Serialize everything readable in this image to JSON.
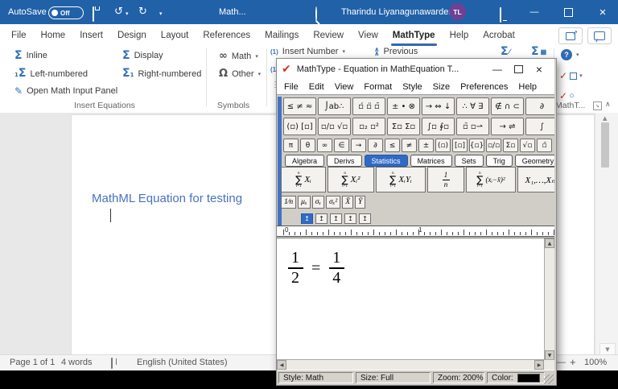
{
  "colors": {
    "titlebar_blue": "#2161a8",
    "accent_blue": "#3272b8",
    "tab_underline": "#3268b1",
    "avatar_purple": "#6e4196",
    "heading_blue": "#4a72bd",
    "selected_palette_tab_blue": "#316ac5"
  },
  "word": {
    "titlebar": {
      "autosave": "AutoSave",
      "autosave_state": "Off",
      "doc_title": "Math...",
      "user": "Tharindu Liyanagunawardena",
      "initials": "TL"
    },
    "icons": {
      "undo": "↺",
      "redo": "↻",
      "chevron": "▾",
      "minimize": "—",
      "close": "×",
      "collapse": "∧",
      "launcher_arrow": "↘",
      "up_chevron": "∧",
      "scroll_up": "▲",
      "scroll_down": "▼"
    },
    "tabs": [
      "File",
      "Home",
      "Insert",
      "Design",
      "Layout",
      "References",
      "Mailings",
      "Review",
      "View",
      "MathType",
      "Help",
      "Acrobat"
    ],
    "active_tab": "MathType",
    "ribbon": {
      "sigma": "Σ",
      "one": "1",
      "pen": "✎",
      "infinity": "∞",
      "omega": "Ω",
      "inline": "Inline",
      "display": "Display",
      "left_numbered": "Left-numbered",
      "right_numbered": "Right-numbered",
      "open_panel": "Open Math Input Panel",
      "math": "Math",
      "other": "Other",
      "insert_equations_group": "Insert Equations",
      "symbols_group": "Symbols",
      "insert_number_icon": "(1)",
      "insert_number": "Insert Number",
      "previous": "Previous",
      "toggle_tex_slash": "∕",
      "grid_glyph": "▦",
      "help": "?",
      "check": "✓",
      "circle_o": "○",
      "mathtype_group": "MathT...",
      "partial_icon": "(1",
      "overflow_dots": "⋮"
    },
    "document": {
      "heading": "MathML Equation for testing"
    },
    "status": {
      "page": "Page 1 of 1",
      "words": "4 words",
      "language": "English (United States)",
      "zoom_minus": "—",
      "zoom_plus": "+",
      "zoom_level": "100%"
    }
  },
  "mt": {
    "logo": "✔",
    "title": "MathType - Equation in MathEquation T...",
    "window_buttons": {
      "minimize": "—",
      "close": "×"
    },
    "menu": [
      "File",
      "Edit",
      "View",
      "Format",
      "Style",
      "Size",
      "Preferences",
      "Help"
    ],
    "row1": [
      "≤ ≠ ≈",
      "⌡ab∴",
      "▫́ ▫̈ ▫̄",
      "± • ⊗",
      "→ ⇔ ↓",
      "∴ ∀ ∃",
      "∉ ∩ ⊂",
      "∂"
    ],
    "row2": [
      "(▫) [▫]",
      "▫∕▫ √▫",
      "▫₂ ▫²",
      "Σ▫ Σ▫",
      "∫▫ ∮▫",
      "▫̄ ▫⇀",
      "→ ⇌",
      "∫"
    ],
    "smallbar": [
      "π",
      "θ",
      "∞",
      "∈",
      "→",
      "∂",
      "≤",
      "≠",
      "±",
      "(▫)",
      "[▫]",
      "{▫}",
      "▫∕▫",
      "Σ▫",
      "√▫",
      "▫̄"
    ],
    "tabs": [
      "Algebra",
      "Derivs",
      "Statistics",
      "Matrices",
      "Sets",
      "Trig",
      "Geometry"
    ],
    "active_tab": "Statistics",
    "templates": {
      "sigma": "∑",
      "sup": "n",
      "sub": "i=1",
      "t1": "Xᵢ",
      "t2": "Xᵢ²",
      "t3": "XᵢYᵢ",
      "t4_num": "1",
      "t4_den": "n",
      "t5": "(xᵢ−x̄)²",
      "t6": "X₁,…,Xₙ"
    },
    "small_templates": [
      "1∕n",
      "μₓ",
      "σₓ",
      "σₓ²",
      "X̄",
      "Ȳ"
    ],
    "align_icon": "↥",
    "ruler": [
      "0",
      "1"
    ],
    "equation": {
      "frac1_num": "1",
      "frac1_den": "2",
      "relation": "=",
      "frac2_num": "1",
      "frac2_den": "4"
    },
    "status": {
      "style": "Style: Math",
      "size": "Size: Full",
      "zoom": "Zoom: 200%",
      "color_label": "Color:"
    },
    "scroll": {
      "up": "▲",
      "down": "▼",
      "left": "◀",
      "right": "▶"
    }
  }
}
